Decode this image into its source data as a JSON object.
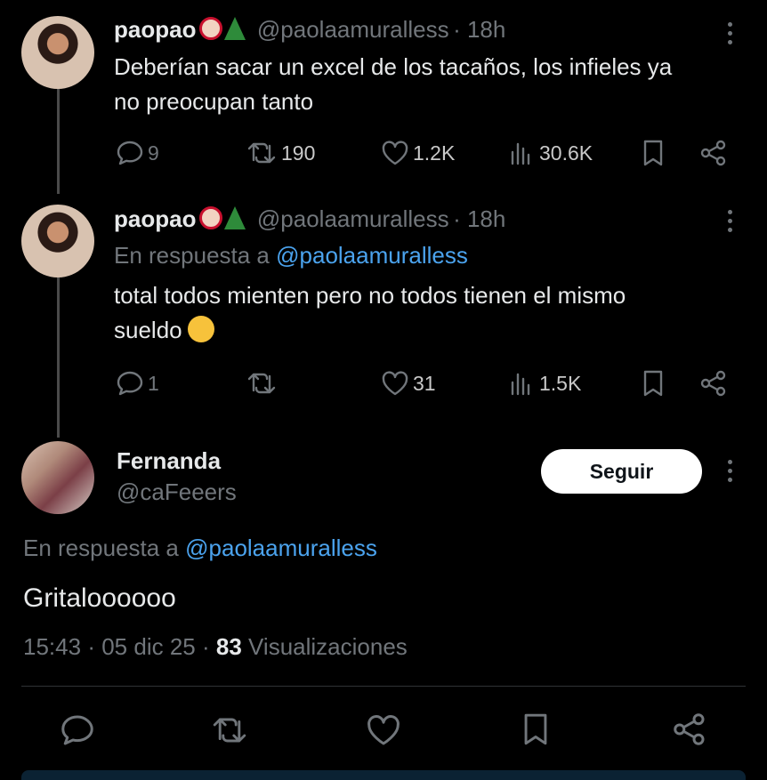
{
  "tweets": [
    {
      "name": "paopao",
      "handle": "@paolaamuralless",
      "time": "· 18h",
      "text_line1": "Deberían sacar un excel de los tacaños, los infieles ya",
      "text_line2": "no preocupan tanto",
      "replies": "9",
      "reposts": "190",
      "likes": "1.2K",
      "views": "30.6K"
    },
    {
      "name": "paopao",
      "handle": "@paolaamuralless",
      "time": "· 18h",
      "reply_prefix": "En respuesta a",
      "reply_to": "@paolaamuralless",
      "text_line1": "total todos mienten pero no todos tienen el mismo",
      "text_line2": "sueldo",
      "replies": "1",
      "likes": "31",
      "views": "1.5K"
    }
  ],
  "main": {
    "name": "Fernanda",
    "handle": "@caFeeers",
    "follow_label": "Seguir",
    "reply_prefix": "En respuesta a",
    "reply_to": "@paolaamuralless",
    "text": "Gritaloooooo",
    "time": "15:43",
    "date": "05 dic 25",
    "views_count": "83",
    "views_label": "Visualizaciones"
  },
  "icons": [
    "reply-icon",
    "repost-icon",
    "like-icon",
    "views-icon",
    "bookmark-icon",
    "share-icon",
    "more-icon"
  ]
}
